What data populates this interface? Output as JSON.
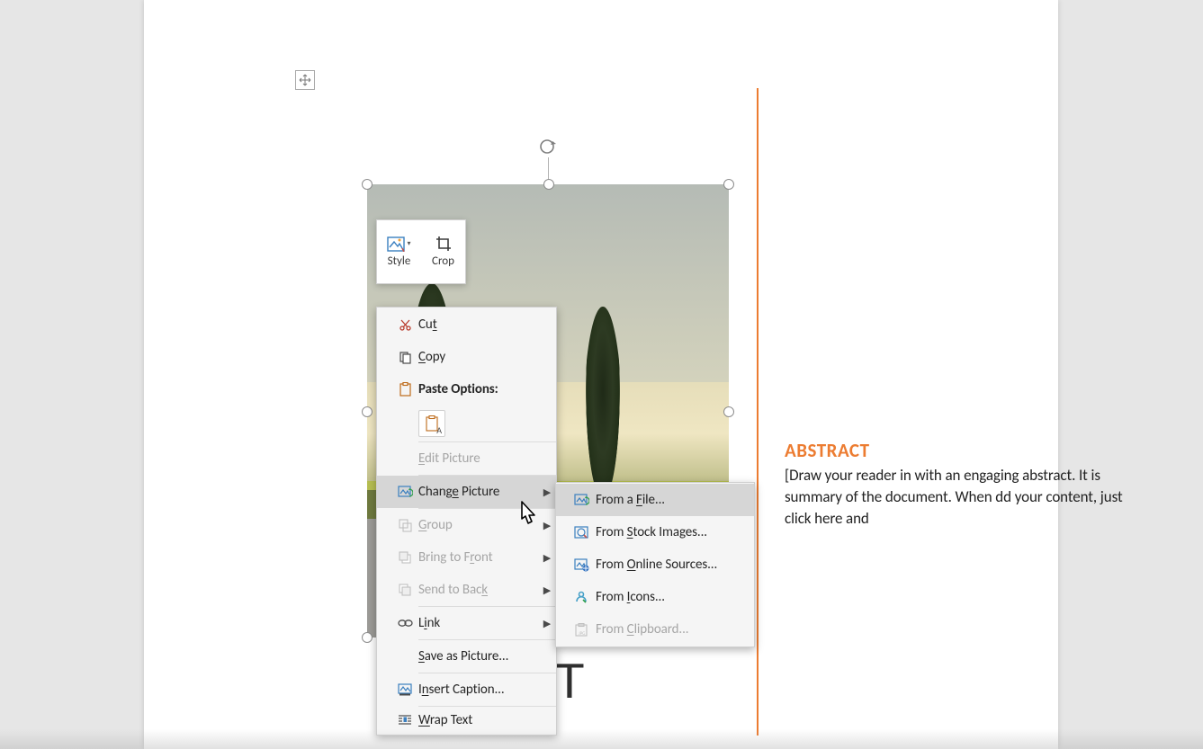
{
  "colors": {
    "accent": "#ec7c31"
  },
  "document": {
    "title_fragment": "[DO                T",
    "abstract_heading": "ABSTRACT",
    "abstract_body": "[Draw your reader in with an engaging abstract. It is                       summary of the document. When                           dd your content, just click here and"
  },
  "mini_toolbar": {
    "style_label": "Style",
    "crop_label": "Crop"
  },
  "context_menu": {
    "cut": "Cut",
    "copy": "Copy",
    "paste_options": "Paste Options:",
    "edit_picture": "Edit Picture",
    "change_picture": "Change Picture",
    "group": "Group",
    "bring_to_front": "Bring to Front",
    "send_to_back": "Send to Back",
    "link": "Link",
    "save_as_picture": "Save as Picture...",
    "insert_caption": "Insert Caption...",
    "wrap_text": "Wrap Text"
  },
  "submenu": {
    "from_file": "From a File...",
    "from_stock": "From Stock Images...",
    "from_online": "From Online Sources...",
    "from_icons": "From Icons...",
    "from_clipboard": "From Clipboard..."
  }
}
